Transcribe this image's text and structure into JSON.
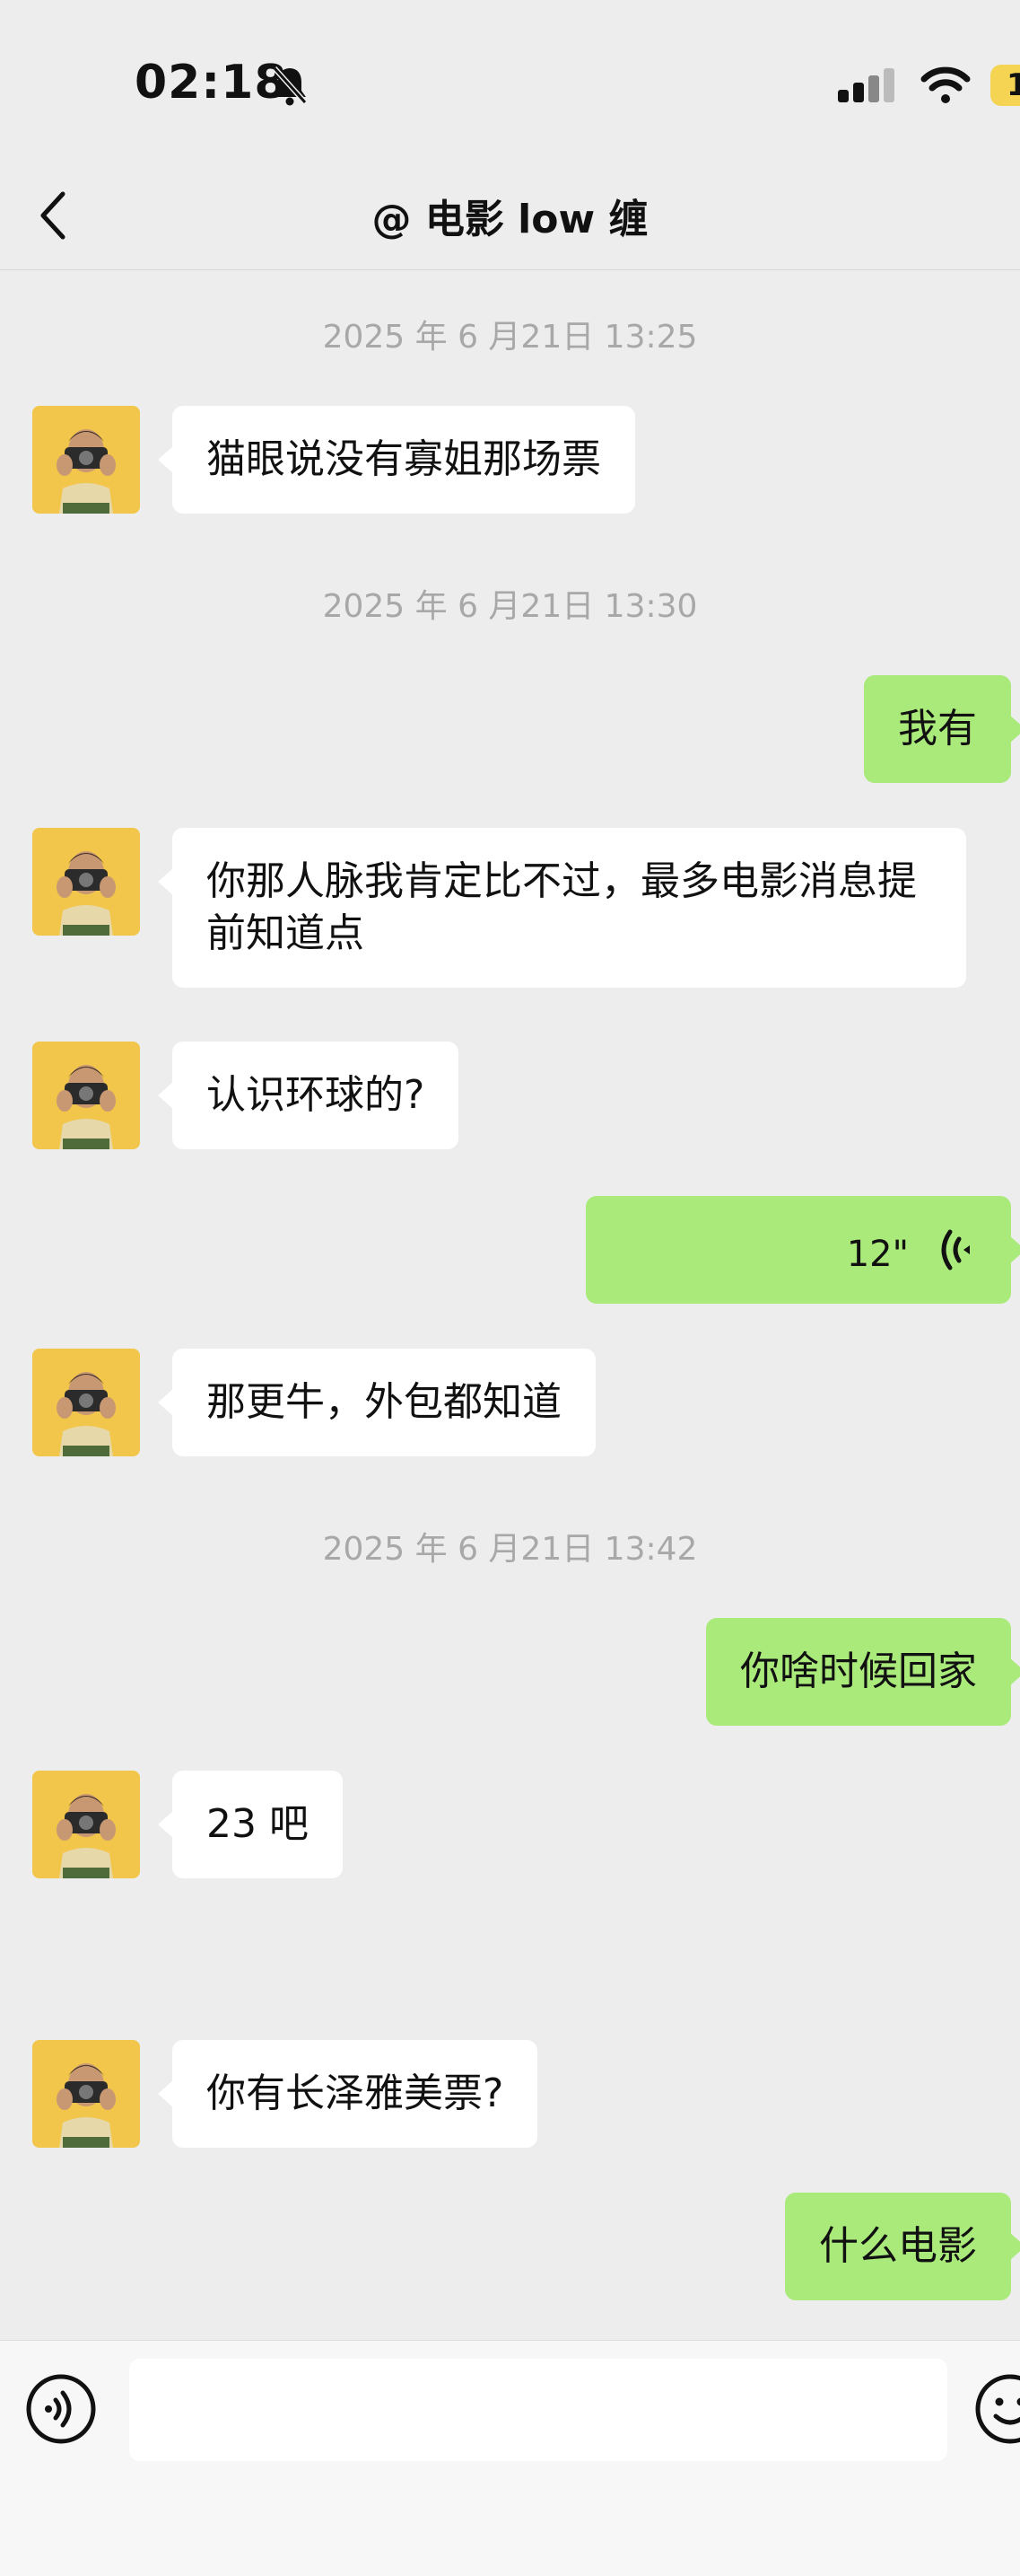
{
  "status_bar": {
    "time": "02:18",
    "battery": "1"
  },
  "nav": {
    "title": "@ 电影 low 缠"
  },
  "messages": {
    "ts1": "2025 年 6 月21日 13:25",
    "m1": "猫眼说没有寡姐那场票",
    "ts2": "2025 年 6 月21日 13:30",
    "m2": "我有",
    "m3": "你那人脉我肯定比不过，最多电影消息提前知道点",
    "m4": "认识环球的?",
    "m5_voice": "12\"",
    "m6": "那更牛，外包都知道",
    "ts3": "2025 年 6 月21日 13:42",
    "m7": "你啥时候回家",
    "m8": "23 吧",
    "m9": "你有长泽雅美票?",
    "m10": "什么电影"
  },
  "colors": {
    "background": "#ededed",
    "outgoing_bubble": "#a9ea7a",
    "incoming_bubble": "#ffffff",
    "timestamp": "#a8a8a8",
    "avatar_bg": "#f2c64a"
  },
  "icons": {
    "back": "chevron-left-icon",
    "mute": "bell-slash-icon",
    "voice": "voice-wave-icon",
    "emoji": "smiley-icon"
  }
}
